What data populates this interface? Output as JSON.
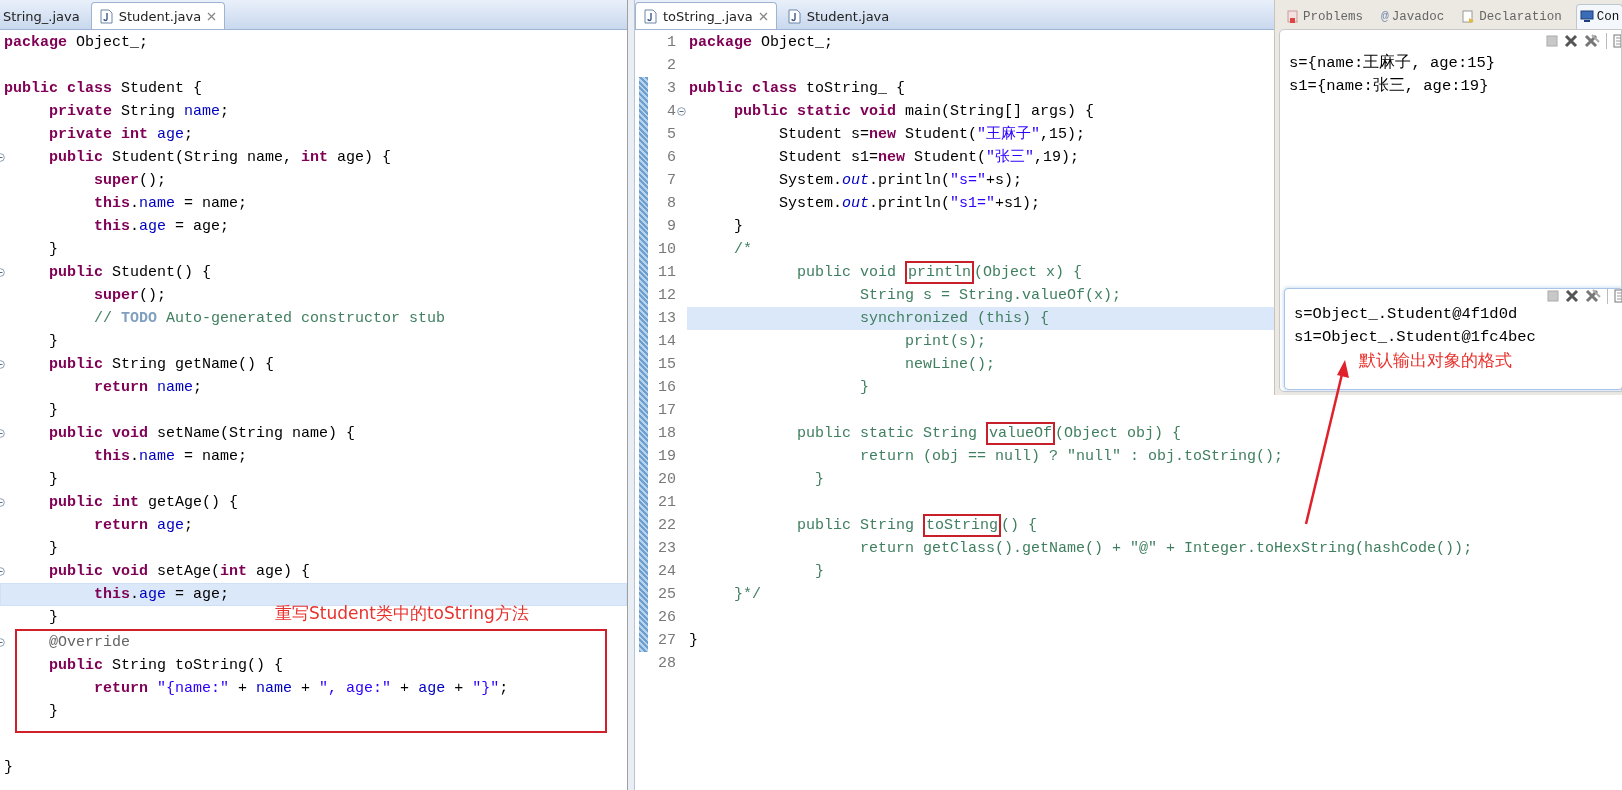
{
  "left_editor": {
    "tabs": [
      {
        "label": "String_.java",
        "selected": false,
        "kind": "partial"
      },
      {
        "label": "Student.java",
        "selected": true,
        "kind": "file"
      }
    ],
    "callout": "重写Student类中的toString方法",
    "lines": [
      {
        "fold": false,
        "current": false,
        "boxed": false,
        "tokens": [
          {
            "text": "package",
            "kind": "kw"
          },
          {
            "text": " Object_;",
            "kind": "plain"
          }
        ]
      },
      {
        "fold": false,
        "current": false,
        "boxed": false
      },
      {
        "fold": false,
        "current": false,
        "boxed": false,
        "tokens": [
          {
            "text": "public class",
            "kind": "kw"
          },
          {
            "text": " Student {",
            "kind": "plain"
          }
        ]
      },
      {
        "fold": false,
        "current": false,
        "boxed": false,
        "tokens": [
          {
            "text": "     private",
            "kind": "kw"
          },
          {
            "text": " String ",
            "kind": "plain"
          },
          {
            "text": "name",
            "kind": "field"
          },
          {
            "text": ";",
            "kind": "plain"
          }
        ]
      },
      {
        "fold": false,
        "current": false,
        "boxed": false,
        "tokens": [
          {
            "text": "     private int",
            "kind": "kw"
          },
          {
            "text": " age",
            "kind": "field"
          },
          {
            "text": ";",
            "kind": "plain"
          }
        ]
      },
      {
        "fold": true,
        "current": false,
        "boxed": false,
        "tokens": [
          {
            "text": "     public",
            "kind": "kw"
          },
          {
            "text": " Student(String name, ",
            "kind": "plain"
          },
          {
            "text": "int",
            "kind": "kw"
          },
          {
            "text": " age) {",
            "kind": "plain"
          }
        ]
      },
      {
        "fold": false,
        "current": false,
        "boxed": false,
        "tokens": [
          {
            "text": "          super",
            "kind": "kw"
          },
          {
            "text": "();",
            "kind": "plain"
          }
        ]
      },
      {
        "fold": false,
        "current": false,
        "boxed": false,
        "tokens": [
          {
            "text": "          this",
            "kind": "kw"
          },
          {
            "text": ".",
            "kind": "plain"
          },
          {
            "text": "name",
            "kind": "field"
          },
          {
            "text": " = name;",
            "kind": "plain"
          }
        ]
      },
      {
        "fold": false,
        "current": false,
        "boxed": false,
        "tokens": [
          {
            "text": "          this",
            "kind": "kw"
          },
          {
            "text": ".",
            "kind": "plain"
          },
          {
            "text": "age",
            "kind": "field"
          },
          {
            "text": " = age;",
            "kind": "plain"
          }
        ]
      },
      {
        "fold": false,
        "current": false,
        "boxed": false,
        "tokens": [
          {
            "text": "     }",
            "kind": "plain"
          }
        ]
      },
      {
        "fold": true,
        "current": false,
        "boxed": false,
        "tokens": [
          {
            "text": "     public",
            "kind": "kw"
          },
          {
            "text": " Student() {",
            "kind": "plain"
          }
        ]
      },
      {
        "fold": false,
        "current": false,
        "boxed": false,
        "tokens": [
          {
            "text": "          super",
            "kind": "kw"
          },
          {
            "text": "();",
            "kind": "plain"
          }
        ]
      },
      {
        "fold": false,
        "current": false,
        "boxed": false,
        "tokens": [
          {
            "text": "          //",
            "kind": "comment"
          },
          {
            "text": " TODO",
            "kind": "todo"
          },
          {
            "text": " Auto-generated constructor stub",
            "kind": "comment"
          }
        ]
      },
      {
        "fold": false,
        "current": false,
        "boxed": false,
        "tokens": [
          {
            "text": "     }",
            "kind": "plain"
          }
        ]
      },
      {
        "fold": true,
        "current": false,
        "boxed": false,
        "tokens": [
          {
            "text": "     public",
            "kind": "kw"
          },
          {
            "text": " String getName() {",
            "kind": "plain"
          }
        ]
      },
      {
        "fold": false,
        "current": false,
        "boxed": false,
        "tokens": [
          {
            "text": "          return",
            "kind": "kw"
          },
          {
            "text": " name",
            "kind": "field"
          },
          {
            "text": ";",
            "kind": "plain"
          }
        ]
      },
      {
        "fold": false,
        "current": false,
        "boxed": false,
        "tokens": [
          {
            "text": "     }",
            "kind": "plain"
          }
        ]
      },
      {
        "fold": true,
        "current": false,
        "boxed": false,
        "tokens": [
          {
            "text": "     public void",
            "kind": "kw"
          },
          {
            "text": " setName(String name) {",
            "kind": "plain"
          }
        ]
      },
      {
        "fold": false,
        "current": false,
        "boxed": false,
        "tokens": [
          {
            "text": "          this",
            "kind": "kw"
          },
          {
            "text": ".",
            "kind": "plain"
          },
          {
            "text": "name",
            "kind": "field"
          },
          {
            "text": " = name;",
            "kind": "plain"
          }
        ]
      },
      {
        "fold": false,
        "current": false,
        "boxed": false,
        "tokens": [
          {
            "text": "     }",
            "kind": "plain"
          }
        ]
      },
      {
        "fold": true,
        "current": false,
        "boxed": false,
        "tokens": [
          {
            "text": "     public int",
            "kind": "kw"
          },
          {
            "text": " getAge() {",
            "kind": "plain"
          }
        ]
      },
      {
        "fold": false,
        "current": false,
        "boxed": false,
        "tokens": [
          {
            "text": "          return",
            "kind": "kw"
          },
          {
            "text": " age",
            "kind": "field"
          },
          {
            "text": ";",
            "kind": "plain"
          }
        ]
      },
      {
        "fold": false,
        "current": false,
        "boxed": false,
        "tokens": [
          {
            "text": "     }",
            "kind": "plain"
          }
        ]
      },
      {
        "fold": true,
        "current": false,
        "boxed": false,
        "tokens": [
          {
            "text": "     public void",
            "kind": "kw"
          },
          {
            "text": " setAge(",
            "kind": "plain"
          },
          {
            "text": "int",
            "kind": "kw"
          },
          {
            "text": " age) {",
            "kind": "plain"
          }
        ]
      },
      {
        "fold": false,
        "current": true,
        "boxed": false,
        "tokens": [
          {
            "text": "          this",
            "kind": "kw"
          },
          {
            "text": ".",
            "kind": "plain"
          },
          {
            "text": "age",
            "kind": "field"
          },
          {
            "text": " = age;",
            "kind": "plain"
          }
        ]
      },
      {
        "fold": false,
        "current": false,
        "boxed": false,
        "tokens": [
          {
            "text": "     }",
            "kind": "plain"
          }
        ]
      },
      {
        "fold": true,
        "current": false,
        "boxed": true,
        "tokens": [
          {
            "text": "     @Override",
            "kind": "annotation"
          }
        ]
      },
      {
        "fold": false,
        "current": false,
        "boxed": true,
        "tokens": [
          {
            "text": "     public",
            "kind": "kw"
          },
          {
            "text": " String toString() {",
            "kind": "plain"
          }
        ]
      },
      {
        "fold": false,
        "current": false,
        "boxed": true,
        "tokens": [
          {
            "text": "          return",
            "kind": "kw"
          },
          {
            "text": " \"{name:\"",
            "kind": "str"
          },
          {
            "text": " + ",
            "kind": "plain"
          },
          {
            "text": "name",
            "kind": "field"
          },
          {
            "text": " + ",
            "kind": "plain"
          },
          {
            "text": "\", age:\"",
            "kind": "str"
          },
          {
            "text": " + ",
            "kind": "plain"
          },
          {
            "text": "age",
            "kind": "field"
          },
          {
            "text": " + ",
            "kind": "plain"
          },
          {
            "text": "\"}\"",
            "kind": "str"
          },
          {
            "text": ";",
            "kind": "plain"
          }
        ]
      },
      {
        "fold": false,
        "current": false,
        "boxed": true,
        "tokens": [
          {
            "text": "     }",
            "kind": "plain"
          }
        ]
      },
      {
        "fold": false,
        "current": false,
        "boxed": false
      },
      {
        "fold": false,
        "current": false,
        "boxed": false,
        "tokens": [
          {
            "text": "}",
            "kind": "plain"
          }
        ]
      }
    ]
  },
  "main_editor": {
    "tabs": [
      {
        "label": "toString_.java",
        "selected": true,
        "kind": "file"
      },
      {
        "label": "Student.java",
        "selected": false,
        "kind": "file"
      }
    ],
    "lines": [
      {
        "number": "1",
        "fold": false,
        "current": false,
        "changed": false,
        "tokens": [
          {
            "text": "package",
            "kind": "kw"
          },
          {
            "text": " Object_;",
            "kind": "plain"
          }
        ]
      },
      {
        "number": "2",
        "fold": false,
        "current": false,
        "changed": false
      },
      {
        "number": "3",
        "fold": false,
        "current": false,
        "changed": true,
        "tokens": [
          {
            "text": "public class",
            "kind": "kw"
          },
          {
            "text": " toString_ {",
            "kind": "plain"
          }
        ]
      },
      {
        "number": "4",
        "fold": true,
        "current": false,
        "changed": true,
        "tokens": [
          {
            "text": "     public static void",
            "kind": "kw"
          },
          {
            "text": " main(String[] args) {",
            "kind": "plain"
          }
        ]
      },
      {
        "number": "5",
        "fold": false,
        "current": false,
        "changed": true,
        "tokens": [
          {
            "text": "          Student s=",
            "kind": "plain"
          },
          {
            "text": "new",
            "kind": "kw"
          },
          {
            "text": " Student(",
            "kind": "plain"
          },
          {
            "text": "\"王麻子\"",
            "kind": "str"
          },
          {
            "text": ",15);",
            "kind": "plain"
          }
        ]
      },
      {
        "number": "6",
        "fold": false,
        "current": false,
        "changed": true,
        "tokens": [
          {
            "text": "          Student s1=",
            "kind": "plain"
          },
          {
            "text": "new",
            "kind": "kw"
          },
          {
            "text": " Student(",
            "kind": "plain"
          },
          {
            "text": "\"张三\"",
            "kind": "str"
          },
          {
            "text": ",19);",
            "kind": "plain"
          }
        ]
      },
      {
        "number": "7",
        "fold": false,
        "current": false,
        "changed": true,
        "tokens": [
          {
            "text": "          System.",
            "kind": "plain"
          },
          {
            "text": "out",
            "kind": "static"
          },
          {
            "text": ".println(",
            "kind": "plain"
          },
          {
            "text": "\"s=\"",
            "kind": "str"
          },
          {
            "text": "+s);",
            "kind": "plain"
          }
        ]
      },
      {
        "number": "8",
        "fold": false,
        "current": false,
        "changed": true,
        "tokens": [
          {
            "text": "          System.",
            "kind": "plain"
          },
          {
            "text": "out",
            "kind": "static"
          },
          {
            "text": ".println(",
            "kind": "plain"
          },
          {
            "text": "\"s1=\"",
            "kind": "str"
          },
          {
            "text": "+s1);",
            "kind": "plain"
          }
        ]
      },
      {
        "number": "9",
        "fold": false,
        "current": false,
        "changed": true,
        "tokens": [
          {
            "text": "     }",
            "kind": "plain"
          }
        ]
      },
      {
        "number": "10",
        "fold": false,
        "current": false,
        "changed": true,
        "tokens": [
          {
            "text": "     /*",
            "kind": "comment"
          }
        ]
      },
      {
        "number": "11",
        "fold": false,
        "current": false,
        "changed": true,
        "tokens": [
          {
            "text": "            public void ",
            "kind": "comment"
          },
          {
            "text": "println",
            "kind": "boxed"
          },
          {
            "text": "(Object x) {",
            "kind": "comment"
          }
        ]
      },
      {
        "number": "12",
        "fold": false,
        "current": false,
        "changed": true,
        "tokens": [
          {
            "text": "                   String s = String.valueOf(x);",
            "kind": "comment"
          }
        ]
      },
      {
        "number": "13",
        "fold": false,
        "current": true,
        "changed": true,
        "tokens": [
          {
            "text": "                   synchronized (this) {",
            "kind": "comment"
          }
        ]
      },
      {
        "number": "14",
        "fold": false,
        "current": false,
        "changed": true,
        "tokens": [
          {
            "text": "                        print(s);",
            "kind": "comment"
          }
        ]
      },
      {
        "number": "15",
        "fold": false,
        "current": false,
        "changed": true,
        "tokens": [
          {
            "text": "                        newLine();",
            "kind": "comment"
          }
        ]
      },
      {
        "number": "16",
        "fold": false,
        "current": false,
        "changed": true,
        "tokens": [
          {
            "text": "                   }",
            "kind": "comment"
          }
        ]
      },
      {
        "number": "17",
        "fold": false,
        "current": false,
        "changed": true
      },
      {
        "number": "18",
        "fold": false,
        "current": false,
        "changed": true,
        "tokens": [
          {
            "text": "            public static String ",
            "kind": "comment"
          },
          {
            "text": "valueOf",
            "kind": "boxed"
          },
          {
            "text": "(Object obj) {",
            "kind": "comment"
          }
        ]
      },
      {
        "number": "19",
        "fold": false,
        "current": false,
        "changed": true,
        "tokens": [
          {
            "text": "                   return (obj == null) ? \"null\" : obj.toString();",
            "kind": "comment"
          }
        ]
      },
      {
        "number": "20",
        "fold": false,
        "current": false,
        "changed": true,
        "tokens": [
          {
            "text": "              }",
            "kind": "comment"
          }
        ]
      },
      {
        "number": "21",
        "fold": false,
        "current": false,
        "changed": true
      },
      {
        "number": "22",
        "fold": false,
        "current": false,
        "changed": true,
        "tokens": [
          {
            "text": "            public String ",
            "kind": "comment"
          },
          {
            "text": "toString",
            "kind": "boxed"
          },
          {
            "text": "() {",
            "kind": "comment"
          }
        ]
      },
      {
        "number": "23",
        "fold": false,
        "current": false,
        "changed": true,
        "tokens": [
          {
            "text": "                   return getClass().getName() + \"@\" + Integer.toHexString(hashCode());",
            "kind": "comment"
          }
        ]
      },
      {
        "number": "24",
        "fold": false,
        "current": false,
        "changed": true,
        "tokens": [
          {
            "text": "              }",
            "kind": "comment"
          }
        ]
      },
      {
        "number": "25",
        "fold": false,
        "current": false,
        "changed": true,
        "tokens": [
          {
            "text": "     }*/",
            "kind": "comment"
          }
        ]
      },
      {
        "number": "26",
        "fold": false,
        "current": false,
        "changed": true
      },
      {
        "number": "27",
        "fold": false,
        "current": false,
        "changed": true,
        "tokens": [
          {
            "text": "}",
            "kind": "plain"
          }
        ]
      },
      {
        "number": "28",
        "fold": false,
        "current": false,
        "changed": false
      }
    ]
  },
  "console": {
    "tabs": [
      {
        "label": "Problems",
        "selected": false,
        "kind": "problems"
      },
      {
        "label": "Javadoc",
        "glyph": "@",
        "selected": false,
        "kind": "javadoc"
      },
      {
        "label": "Declaration",
        "selected": false,
        "kind": "declaration"
      },
      {
        "label": "Con",
        "selected": true,
        "kind": "console"
      }
    ],
    "output": [
      "s={name:王麻子, age:15}",
      "s1={name:张三, age:19}"
    ],
    "inset": {
      "output": [
        "s=Object_.Student@4f1d0d",
        "s1=Object_.Student@1fc4bec"
      ],
      "note": "默认输出对象的格式"
    }
  }
}
